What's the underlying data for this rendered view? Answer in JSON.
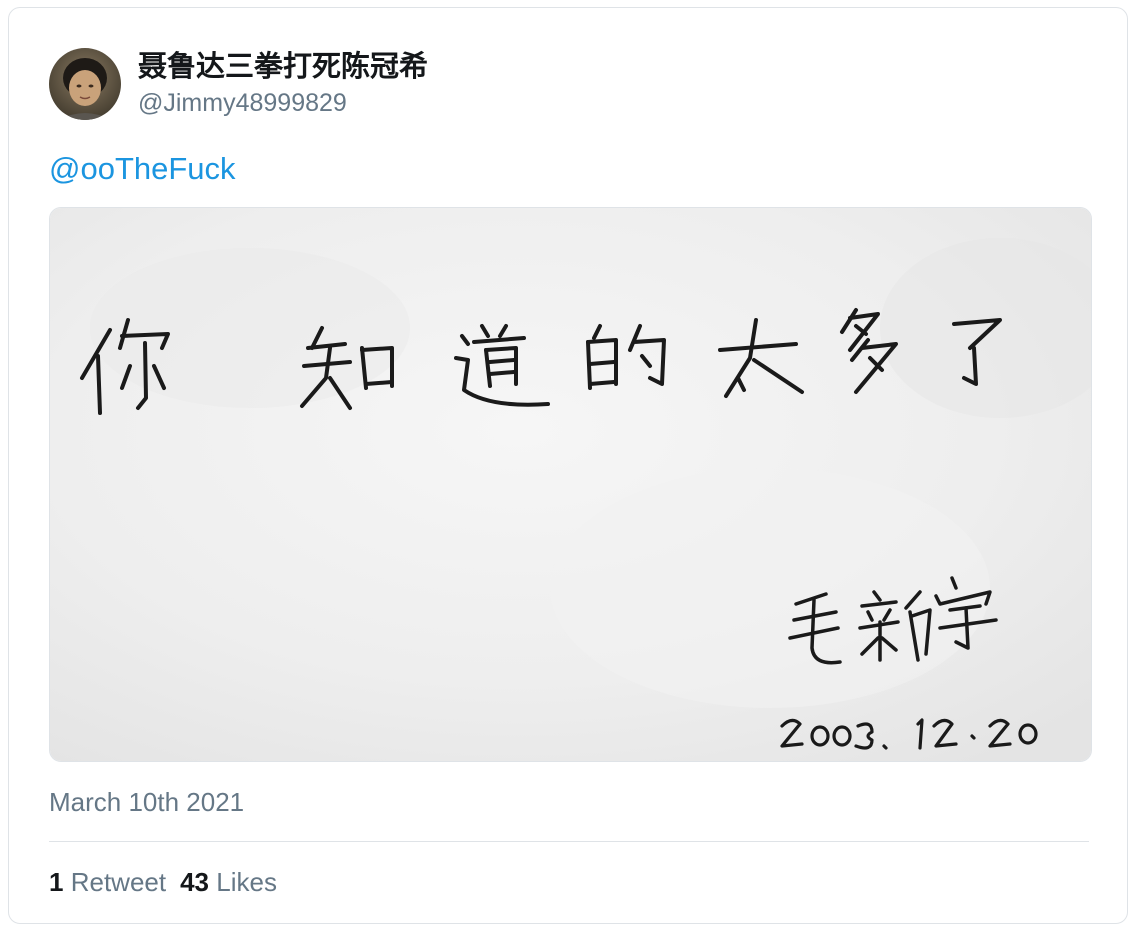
{
  "author": {
    "name": "聂鲁达三拳打死陈冠希",
    "handle": "@Jimmy48999829"
  },
  "tweet": {
    "mention": "@ooTheFuck",
    "date": "March 10th 2021"
  },
  "image": {
    "handwriting_text": "你 知道的太多了",
    "signature": "毛新宇",
    "date_text": "2003. 12.20"
  },
  "stats": {
    "retweets_count": "1",
    "retweets_label": "Retweet",
    "likes_count": "43",
    "likes_label": "Likes"
  },
  "colors": {
    "link": "#1b95e0",
    "secondary_text": "#657786",
    "primary_text": "#14171a",
    "border": "#dfe3e7"
  }
}
